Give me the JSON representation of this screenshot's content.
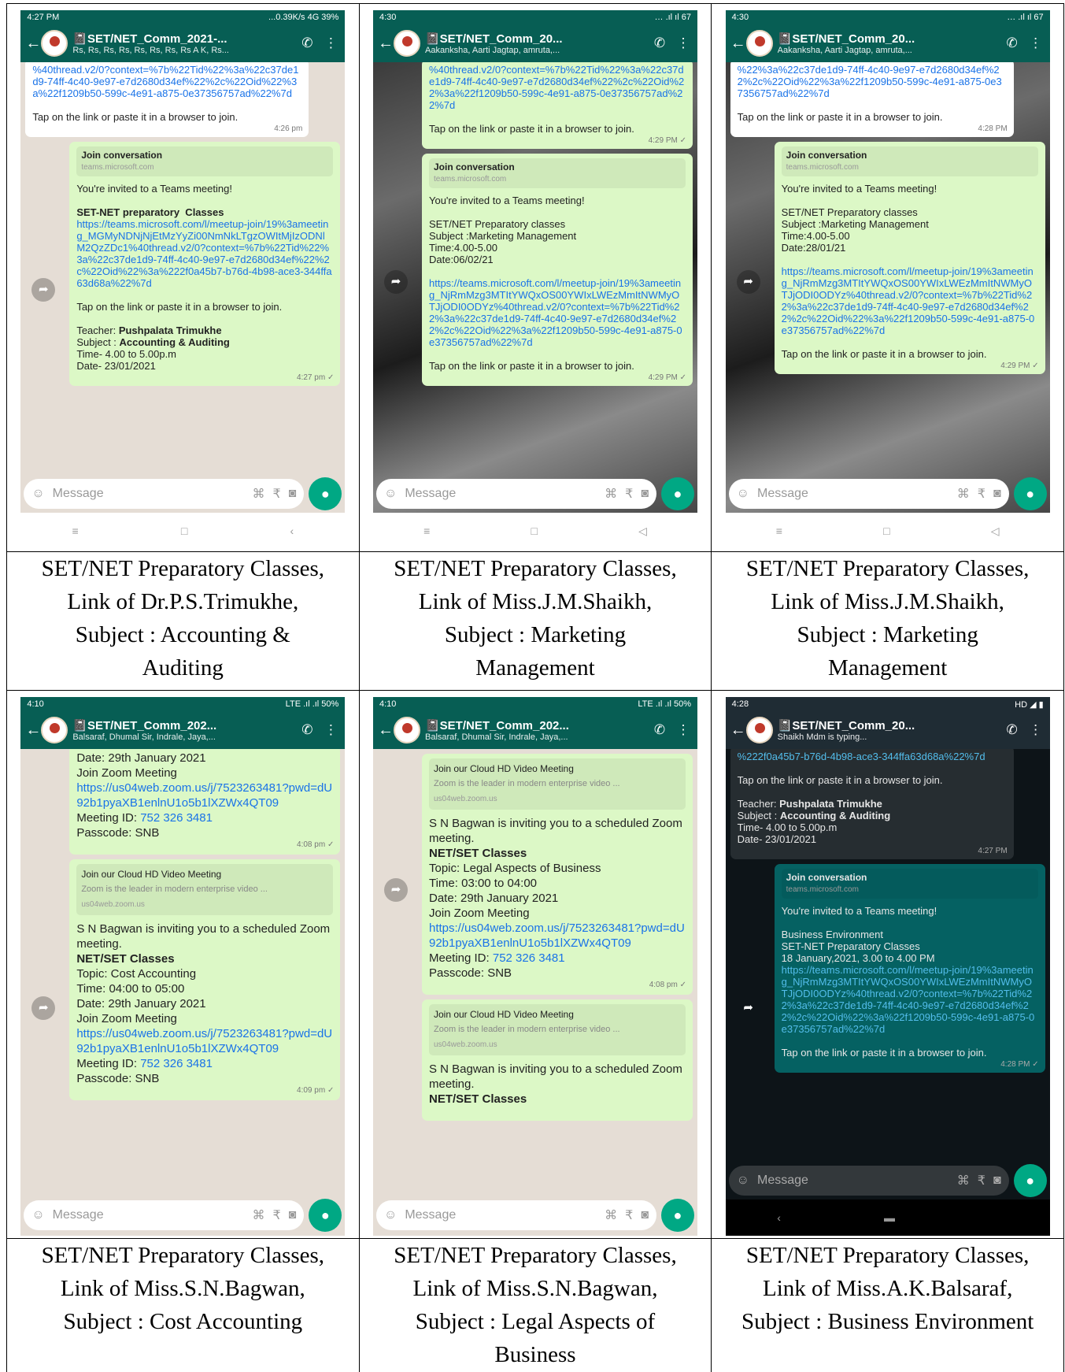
{
  "cells": [
    {
      "status": {
        "time": "4:27 PM",
        "right": "...0.39K/s  4G  39%"
      },
      "chat": {
        "title": "📓SET/NET_Comm_2021-...",
        "subtitle": "Rs, Rs, Rs, Rs, Rs, Rs, Rs, Rs A K, Rs..."
      },
      "b1": {
        "text": "%40thread.v2/0?context=%7b%22Tid%22%3a%22c37de1d9-74ff-4c40-9e97-e7d2680d34ef%22%2c%22Oid%22%3a%22f1209b50-599c-4e91-a875-0e37356757ad%22%7d",
        "foot": "Tap on the link or paste it in a browser to join.",
        "time": "4:26 pm"
      },
      "b2": {
        "prev_title": "Join conversation",
        "prev_url": "teams.microsoft.com",
        "invite": "You're invited to a Teams meeting!",
        "heading": "SET-NET preparatory  Classes",
        "link": "https://teams.microsoft.com/l/meetup-join/19%3ameeting_MGMyNDNjNjEtMzYyZi00NmNkLTgzOWItMjIzODNlM2QzZDc1%40thread.v2/0?context=%7b%22Tid%22%3a%22c37de1d9-74ff-4c40-9e97-e7d2680d34ef%22%2c%22Oid%22%3a%222f0a45b7-b76d-4b98-ace3-344ffa63d68a%22%7d",
        "tap": "Tap on the link or paste it in a browser to join.",
        "teacher_l": "Teacher: ",
        "teacher_v": "Pushpalata Trimukhe",
        "subject_l": "Subject : ",
        "subject_v": "Accounting & Auditing",
        "time_line": "Time- 4.00 to 5.00p.m",
        "date_line": "Date- 23/01/2021",
        "time": "4:27 pm ✓"
      },
      "input": "Message",
      "caption": [
        "SET/NET Preparatory Classes,",
        "Link of Dr.P.S.Trimukhe,",
        "Subject : Accounting &",
        "Auditing"
      ]
    },
    {
      "status": {
        "time": "4:30",
        "right": "… .ıl ıl 67"
      },
      "chat": {
        "title": "📓SET/NET_Comm_20...",
        "subtitle": "Aakanksha, Aarti Jagtap, amruta,..."
      },
      "b1": {
        "text": "%40thread.v2/0?context=%7b%22Tid%22%3a%22c37de1d9-74ff-4c40-9e97-e7d2680d34ef%22%2c%22Oid%22%3a%22f1209b50-599c-4e91-a875-0e37356757ad%22%7d",
        "foot": "Tap on the link or paste it in a browser to join.",
        "time": "4:29 PM ✓"
      },
      "b2": {
        "prev_title": "Join conversation",
        "prev_url": "teams.microsoft.com",
        "invite": "You're invited to a Teams meeting!",
        "body": "SET/NET Preparatory classes\nSubject :Marketing Management\nTime:4.00-5.00\nDate:06/02/21",
        "link": "https://teams.microsoft.com/l/meetup-join/19%3ameeting_NjRmMzg3MTItYWQxOS00YWIxLWEzMmItNWMyOTJjODI0ODYz%40thread.v2/0?context=%7b%22Tid%22%3a%22c37de1d9-74ff-4c40-9e97-e7d2680d34ef%22%2c%22Oid%22%3a%22f1209b50-599c-4e91-a875-0e37356757ad%22%7d",
        "tap": "Tap on the link or paste it in a browser to join.",
        "time": "4:29 PM ✓"
      },
      "input": "Message",
      "caption": [
        "SET/NET Preparatory Classes,",
        "Link of Miss.J.M.Shaikh,",
        "Subject : Marketing",
        "Management"
      ]
    },
    {
      "status": {
        "time": "4:30",
        "right": "… .ıl ıl 67"
      },
      "chat": {
        "title": "📓SET/NET_Comm_20...",
        "subtitle": "Aakanksha, Aarti Jagtap, amruta,..."
      },
      "b1": {
        "text": "%22%3a%22c37de1d9-74ff-4c40-9e97-e7d2680d34ef%22%2c%22Oid%22%3a%22f1209b50-599c-4e91-a875-0e37356757ad%22%7d",
        "foot": "Tap on the link or paste it in a browser to join.",
        "time": "4:28 PM"
      },
      "b2": {
        "prev_title": "Join conversation",
        "prev_url": "teams.microsoft.com",
        "invite": "You're invited to a Teams meeting!",
        "body": "SET/NET Preparatory classes\nSubject :Marketing Management\nTime:4.00-5.00\nDate:28/01/21",
        "link": "https://teams.microsoft.com/l/meetup-join/19%3ameeting_NjRmMzg3MTItYWQxOS00YWIxLWEzMmItNWMyOTJjODI0ODYz%40thread.v2/0?context=%7b%22Tid%22%3a%22c37de1d9-74ff-4c40-9e97-e7d2680d34ef%22%2c%22Oid%22%3a%22f1209b50-599c-4e91-a875-0e37356757ad%22%7d",
        "tap": "Tap on the link or paste it in a browser to join.",
        "time": "4:29 PM ✓"
      },
      "input": "Message",
      "caption": [
        "SET/NET Preparatory Classes,",
        "Link of Miss.J.M.Shaikh,",
        "Subject : Marketing",
        "Management"
      ]
    },
    {
      "status": {
        "time": "4:10",
        "right": "LTE .ıl .ıl 50%"
      },
      "chat": {
        "title": "📓SET/NET_Comm_202...",
        "subtitle": "Balsaraf, Dhumal Sir, Indrale, Jaya,..."
      },
      "b1": {
        "text": "Date: 29th January 2021\nJoin Zoom Meeting",
        "link": "https://us04web.zoom.us/j/7523263481?pwd=dU92b1pyaXB1enlnU1o5b1lXZWx4QT09",
        "tail_l": "Meeting ID: ",
        "tail_v": "752 326 3481",
        "pass": "Passcode: SNB",
        "time": "4:08 pm ✓"
      },
      "b2": {
        "prev_title": "Join our Cloud HD Video Meeting",
        "prev_desc": "Zoom is the leader in modern enterprise video ...",
        "prev_url": "us04web.zoom.us",
        "body": "S N Bagwan is inviting you to a scheduled Zoom meeting.",
        "heading": "NET/SET Classes",
        "details": "Topic: Cost Accounting\nTime: 04:00 to 05:00\nDate: 29th January 2021\nJoin Zoom Meeting",
        "link": "https://us04web.zoom.us/j/7523263481?pwd=dU92b1pyaXB1enlnU1o5b1lXZWx4QT09",
        "tail_l": "Meeting ID: ",
        "tail_v": "752 326 3481",
        "pass": "Passcode: SNB",
        "time": "4:09 pm ✓"
      },
      "input": "Message",
      "caption": [
        "SET/NET Preparatory Classes,",
        "Link of Miss.S.N.Bagwan,",
        "Subject : Cost Accounting"
      ]
    },
    {
      "status": {
        "time": "4:10",
        "right": "LTE .ıl .ıl 50%"
      },
      "chat": {
        "title": "📓SET/NET_Comm_202...",
        "subtitle": "Balsaraf, Dhumal Sir, Indrale, Jaya,..."
      },
      "b1": {
        "prev_title": "Join our Cloud HD Video Meeting",
        "prev_desc": "Zoom is the leader in modern enterprise video ...",
        "prev_url": "us04web.zoom.us",
        "body": "S N Bagwan is inviting you to a scheduled Zoom meeting.",
        "heading": "NET/SET Classes",
        "details": "Topic: Legal Aspects of Business\nTime: 03:00 to 04:00\nDate: 29th January 2021\nJoin Zoom Meeting",
        "link": "https://us04web.zoom.us/j/7523263481?pwd=dU92b1pyaXB1enlnU1o5b1lXZWx4QT09",
        "tail_l": "Meeting ID: ",
        "tail_v": "752 326 3481",
        "pass": "Passcode: SNB",
        "time": "4:08 pm ✓"
      },
      "b2": {
        "prev_title": "Join our Cloud HD Video Meeting",
        "prev_desc": "Zoom is the leader in modern enterprise video ...",
        "prev_url": "us04web.zoom.us",
        "body": "S N Bagwan is inviting you to a scheduled Zoom meeting.",
        "heading": "NET/SET Classes"
      },
      "input": "Message",
      "caption": [
        "SET/NET Preparatory Classes,",
        "Link of Miss.S.N.Bagwan,",
        "Subject : Legal Aspects of",
        "Business"
      ]
    },
    {
      "status": {
        "time": "4:28",
        "right": "HD ◢ ▮"
      },
      "chat": {
        "title": "📓SET/NET_Comm_20...",
        "subtitle": "Shaikh Mdm is typing..."
      },
      "b1": {
        "text": "%222f0a45b7-b76d-4b98-ace3-344ffa63d68a%22%7d",
        "foot": "Tap on the link or paste it in a browser to join.",
        "teacher_l": "Teacher: ",
        "teacher_v": "Pushpalata Trimukhe",
        "subject_l": "Subject : ",
        "subject_v": "Accounting & Auditing",
        "time_line": "Time- 4.00 to 5.00p.m",
        "date_line": "Date- 23/01/2021",
        "time": "4:27 PM"
      },
      "b2": {
        "prev_title": "Join conversation",
        "prev_url": "teams.microsoft.com",
        "invite": "You're invited to a Teams meeting!",
        "body": "Business Environment\nSET-NET Preparatory Classes\n18 January,2021, 3.00 to 4.00 PM",
        "link": "https://teams.microsoft.com/l/meetup-join/19%3ameeting_NjRmMzg3MTItYWQxOS00YWIxLWEzMmItNWMyOTJjODI0ODYz%40thread.v2/0?context=%7b%22Tid%22%3a%22c37de1d9-74ff-4c40-9e97-e7d2680d34ef%22%2c%22Oid%22%3a%22f1209b50-599c-4e91-a875-0e37356757ad%22%7d",
        "tap": "Tap on the link or paste it in a browser to join.",
        "time": "4:28 PM ✓"
      },
      "input": "Message",
      "caption": [
        "SET/NET Preparatory Classes,",
        "Link of Miss.A.K.Balsaraf,",
        "Subject : Business Environment"
      ]
    }
  ]
}
